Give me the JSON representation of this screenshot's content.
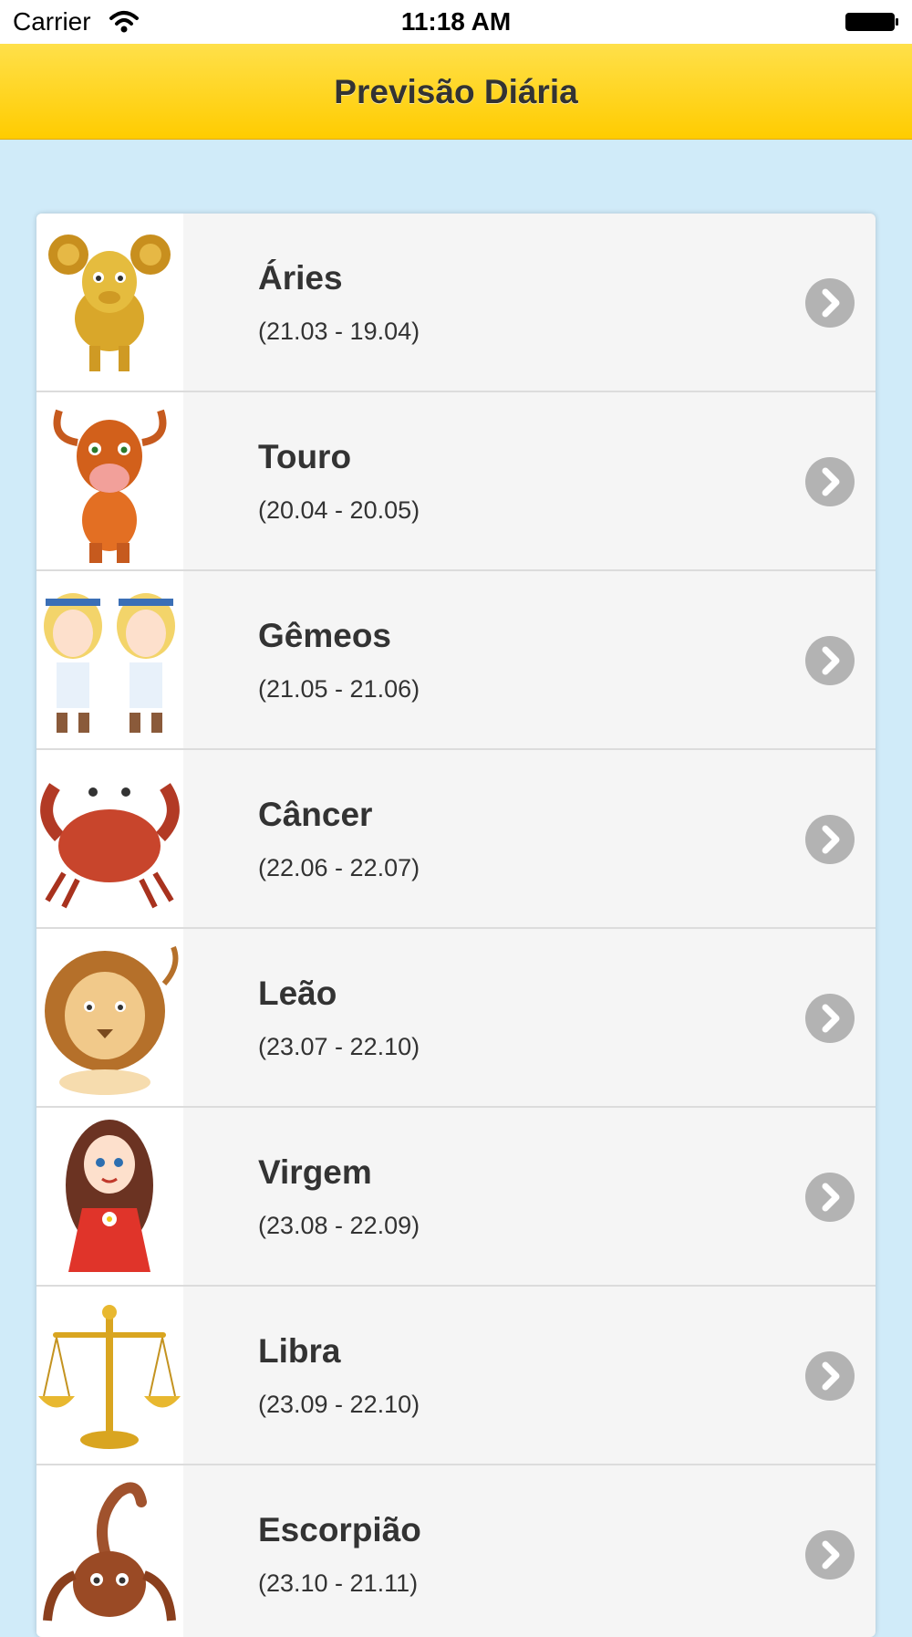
{
  "status_bar": {
    "carrier": "Carrier",
    "time": "11:18 AM"
  },
  "nav": {
    "title": "Previsão Diária"
  },
  "colors": {
    "nav_yellow": "#ffcc00",
    "background": "#d0ebf9",
    "chevron_grey": "#b3b3b3"
  },
  "signs": [
    {
      "name": "Áries",
      "dates": "(21.03 - 19.04)",
      "icon": "aries-ram-icon"
    },
    {
      "name": "Touro",
      "dates": "(20.04 - 20.05)",
      "icon": "taurus-bull-icon"
    },
    {
      "name": "Gêmeos",
      "dates": "(21.05 - 21.06)",
      "icon": "gemini-twins-icon"
    },
    {
      "name": "Câncer",
      "dates": "(22.06 - 22.07)",
      "icon": "cancer-crab-icon"
    },
    {
      "name": "Leão",
      "dates": "(23.07 - 22.10)",
      "icon": "leo-lion-icon"
    },
    {
      "name": "Virgem",
      "dates": "(23.08 - 22.09)",
      "icon": "virgo-girl-icon"
    },
    {
      "name": "Libra",
      "dates": "(23.09 - 22.10)",
      "icon": "libra-scales-icon"
    },
    {
      "name": "Escorpião",
      "dates": "(23.10 - 21.11)",
      "icon": "scorpio-scorpion-icon"
    }
  ]
}
